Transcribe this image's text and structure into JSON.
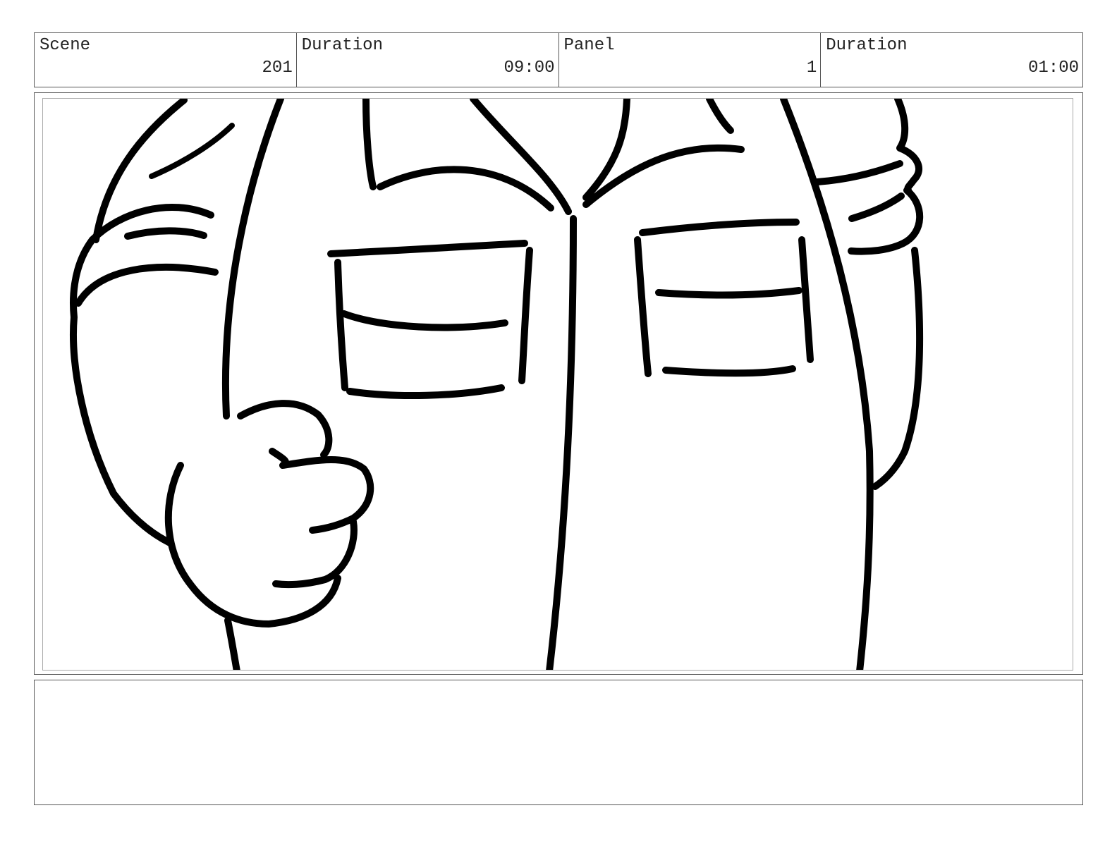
{
  "header": {
    "scene": {
      "label": "Scene",
      "value": "201"
    },
    "scene_duration": {
      "label": "Duration",
      "value": "09:00"
    },
    "panel": {
      "label": "Panel",
      "value": "1"
    },
    "panel_duration": {
      "label": "Duration",
      "value": "01:00"
    }
  },
  "drawing": {
    "subject": "character-torso-shirt-closeup",
    "stroke_color": "#000000"
  },
  "notes": {
    "text": ""
  }
}
